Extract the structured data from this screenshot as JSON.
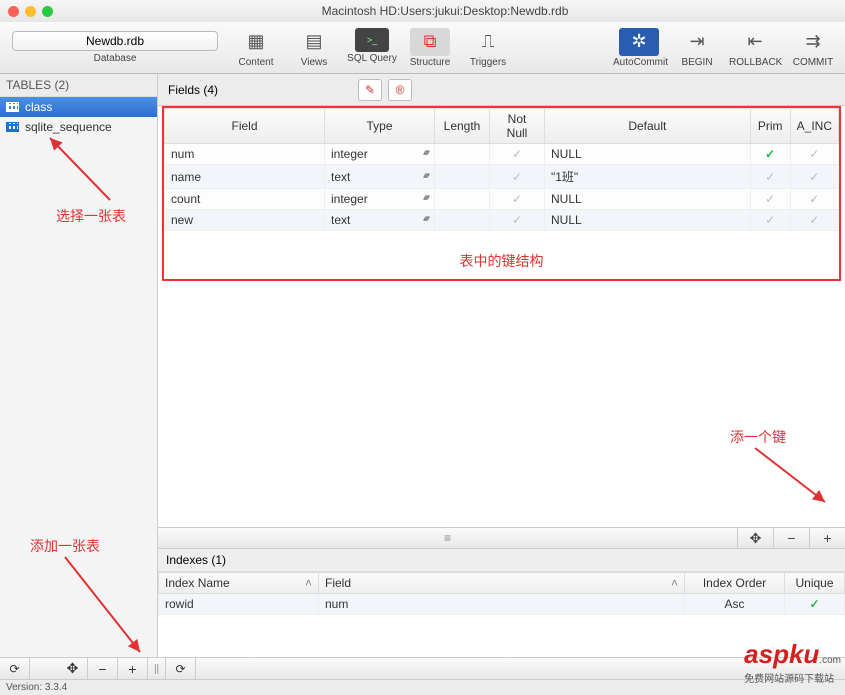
{
  "window": {
    "title": "Macintosh HD:Users:jukui:Desktop:Newdb.rdb"
  },
  "database": {
    "button": "Newdb.rdb",
    "caption": "Database"
  },
  "toolbar": {
    "content": "Content",
    "views": "Views",
    "sqlquery": "SQL Query",
    "structure": "Structure",
    "triggers": "Triggers",
    "autocommit": "AutoCommit",
    "begin": "BEGIN",
    "rollback": "ROLLBACK",
    "commit": "COMMIT"
  },
  "sidebar": {
    "header": "TABLES (2)",
    "t0": "class",
    "t1": "sqlite_sequence"
  },
  "fields": {
    "header": "Fields (4)",
    "cols": {
      "field": "Field",
      "type": "Type",
      "length": "Length",
      "notnull": "Not Null",
      "default": "Default",
      "prim": "Prim",
      "ainc": "A_INC"
    },
    "r0": {
      "field": "num",
      "type": "integer",
      "default": "NULL"
    },
    "r1": {
      "field": "name",
      "type": "text",
      "default": "\"1班\""
    },
    "r2": {
      "field": "count",
      "type": "integer",
      "default": "NULL"
    },
    "r3": {
      "field": "new",
      "type": "text",
      "default": "NULL"
    },
    "caption": "表中的键结构"
  },
  "indexes": {
    "header": "Indexes (1)",
    "cols": {
      "name": "Index Name",
      "field": "Field",
      "order": "Index Order",
      "unique": "Unique"
    },
    "r0": {
      "name": "rowid",
      "field": "num",
      "order": "Asc"
    }
  },
  "annotations": {
    "selectTable": "选择一张表",
    "addTable": "添加一张表",
    "addKey": "添一个键"
  },
  "footer": {
    "version": "Version: 3.3.4"
  },
  "logo": {
    "main": "aspku",
    "dom": ".com",
    "sub": "免费网站源码下载站"
  }
}
